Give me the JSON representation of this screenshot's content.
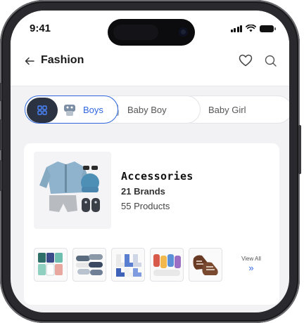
{
  "status_bar": {
    "time": "9:41"
  },
  "header": {
    "title": "Fashion"
  },
  "category_chips": [
    {
      "label": "Boys",
      "active": true
    },
    {
      "label": "Baby Boy",
      "active": false
    },
    {
      "label": "Baby Girl",
      "active": false
    }
  ],
  "category_card": {
    "title": "Accessories",
    "brands": "21 Brands",
    "products": "55 Products",
    "view_all": "View All"
  },
  "colors": {
    "accent": "#2f66e0",
    "grid_button": "#2b3342"
  },
  "icons": [
    "back-arrow-icon",
    "heart-icon",
    "search-icon",
    "grid-icon",
    "chevron-double-right-icon"
  ]
}
